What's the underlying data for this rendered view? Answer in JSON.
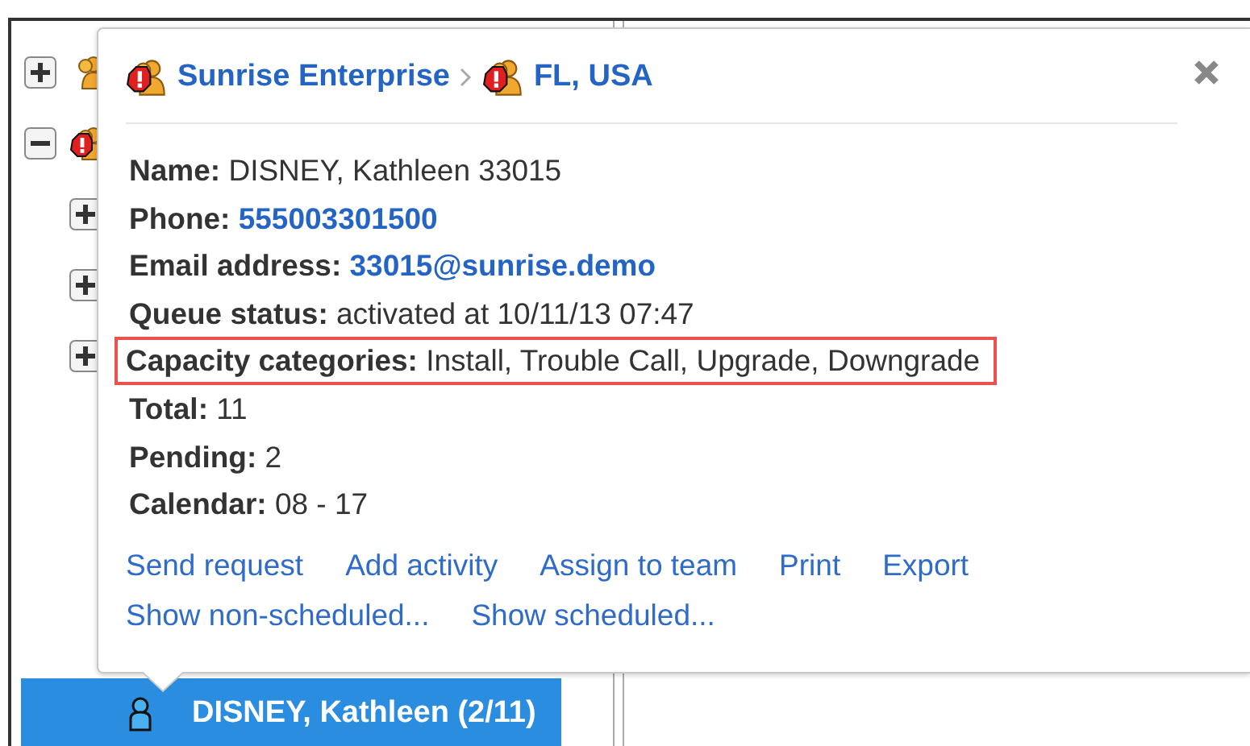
{
  "tree": {
    "nodes": [
      {
        "kind": "group",
        "expanded": false
      },
      {
        "kind": "alert-group",
        "expanded": true,
        "children": [
          {
            "expanded": false
          },
          {
            "expanded": false
          },
          {
            "expanded": false
          }
        ]
      }
    ],
    "selected_item": {
      "label": "DISNEY, Kathleen (2/11)",
      "selected": true
    }
  },
  "popup": {
    "breadcrumb": [
      {
        "label": "Sunrise Enterprise",
        "alert": true
      },
      {
        "label": "FL, USA",
        "alert": true
      }
    ],
    "fields": [
      {
        "label": "Name:",
        "value": "DISNEY, Kathleen 33015",
        "kind": "text",
        "highlighted": false
      },
      {
        "label": "Phone:",
        "value": "555003301500",
        "kind": "link",
        "highlighted": false
      },
      {
        "label": "Email address:",
        "value": "33015@sunrise.demo",
        "kind": "link",
        "highlighted": false
      },
      {
        "label": "Queue status:",
        "value": "activated at 10/11/13 07:47",
        "kind": "text",
        "highlighted": false
      },
      {
        "label": "Capacity categories:",
        "value": "Install, Trouble Call, Upgrade, Downgrade",
        "kind": "text",
        "highlighted": true
      },
      {
        "label": "Total:",
        "value": "11",
        "kind": "text",
        "highlighted": false
      },
      {
        "label": "Pending:",
        "value": "2",
        "kind": "text",
        "highlighted": false
      },
      {
        "label": "Calendar:",
        "value": " 08 - 17",
        "kind": "text",
        "highlighted": false
      }
    ],
    "actions": [
      [
        "Send request",
        "Add activity",
        "Assign to team",
        "Print",
        "Export"
      ],
      [
        "Show non-scheduled...",
        "Show scheduled..."
      ]
    ]
  }
}
